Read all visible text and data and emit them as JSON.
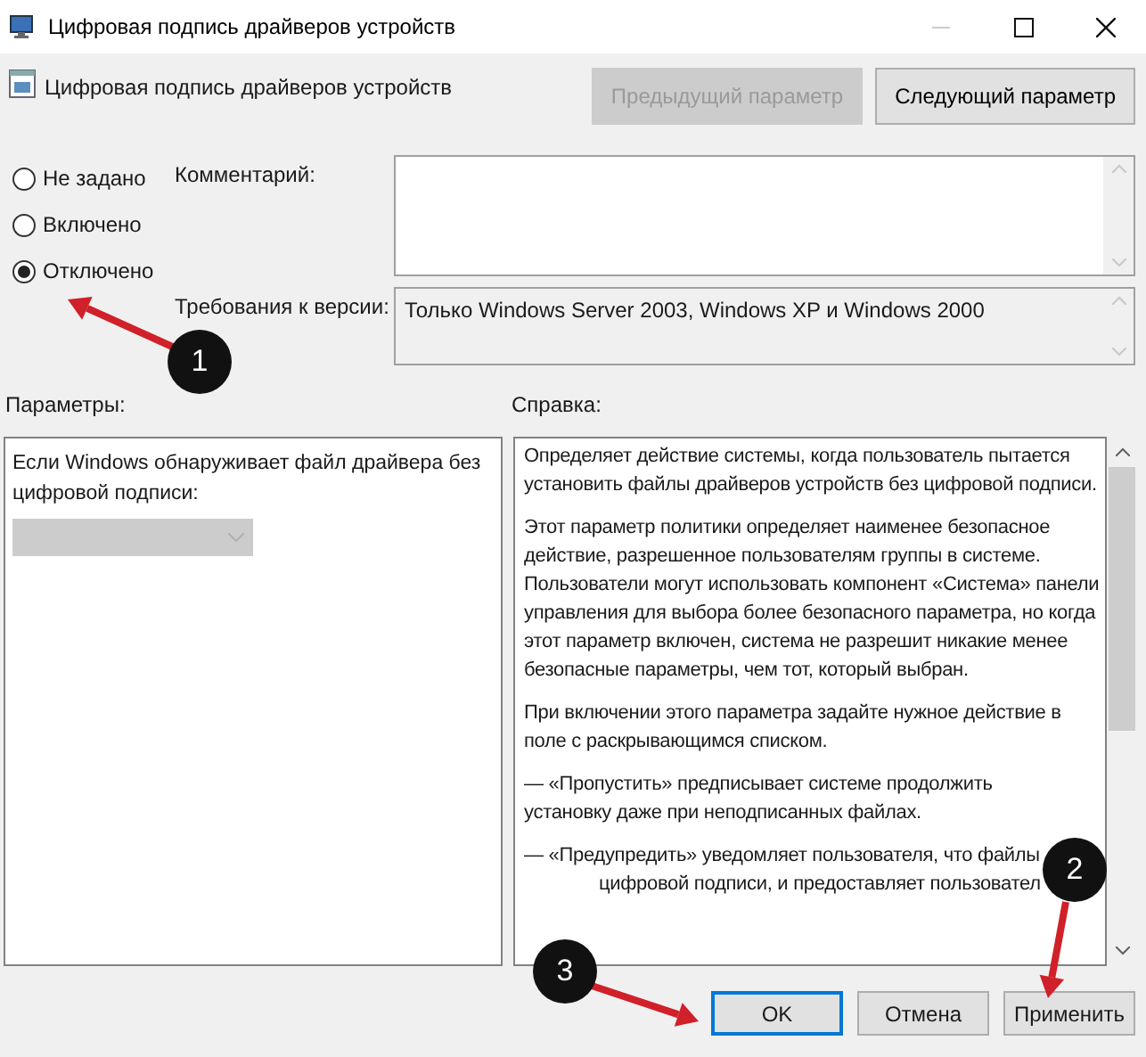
{
  "window": {
    "title": "Цифровая подпись драйверов устройств"
  },
  "header": {
    "title": "Цифровая подпись драйверов устройств",
    "buttons": [
      {
        "label": "Предыдущий параметр",
        "disabled": true
      },
      {
        "label": "Следующий параметр",
        "disabled": false
      }
    ]
  },
  "state_options": [
    {
      "label": "Не задано",
      "selected": false
    },
    {
      "label": "Включено",
      "selected": false
    },
    {
      "label": "Отключено",
      "selected": true
    }
  ],
  "comment": {
    "label": "Комментарий:"
  },
  "version": {
    "label": "Требования к версии:",
    "value": "Только Windows Server 2003, Windows XP и Windows 2000"
  },
  "options": {
    "label": "Параметры:",
    "prompt": "Если Windows обнаруживает файл драйвера без цифровой подписи:",
    "dropdown": {
      "disabled": true
    }
  },
  "help": {
    "label": "Справка:",
    "paragraphs": [
      "Определяет действие системы, когда пользователь пытается установить файлы драйверов устройств без цифровой подписи.",
      "Этот параметр политики определяет наименее безопасное действие, разрешенное пользователям группы в системе. Пользователи могут использовать компонент «Система» панели управления для выбора более безопасного параметра, но когда этот параметр включен, система не разрешит никакие менее безопасные параметры, чем тот, который выбран.",
      "При включении этого параметра задайте нужное действие в поле с раскрывающимся списком.",
      "— «Пропустить» предписывает системе продолжить установку даже при неподписанных файлах."
    ],
    "partial_lines": [
      "— «Предупредить» уведомляет пользователя, что файлы",
      "цифровой подписи, и предоставляет пользовател"
    ]
  },
  "footer_buttons": [
    {
      "label": "OK",
      "default": true
    },
    {
      "label": "Отмена",
      "default": false
    },
    {
      "label": "Применить",
      "default": false
    }
  ],
  "annotations": [
    {
      "number": "1"
    },
    {
      "number": "2"
    },
    {
      "number": "3"
    }
  ]
}
